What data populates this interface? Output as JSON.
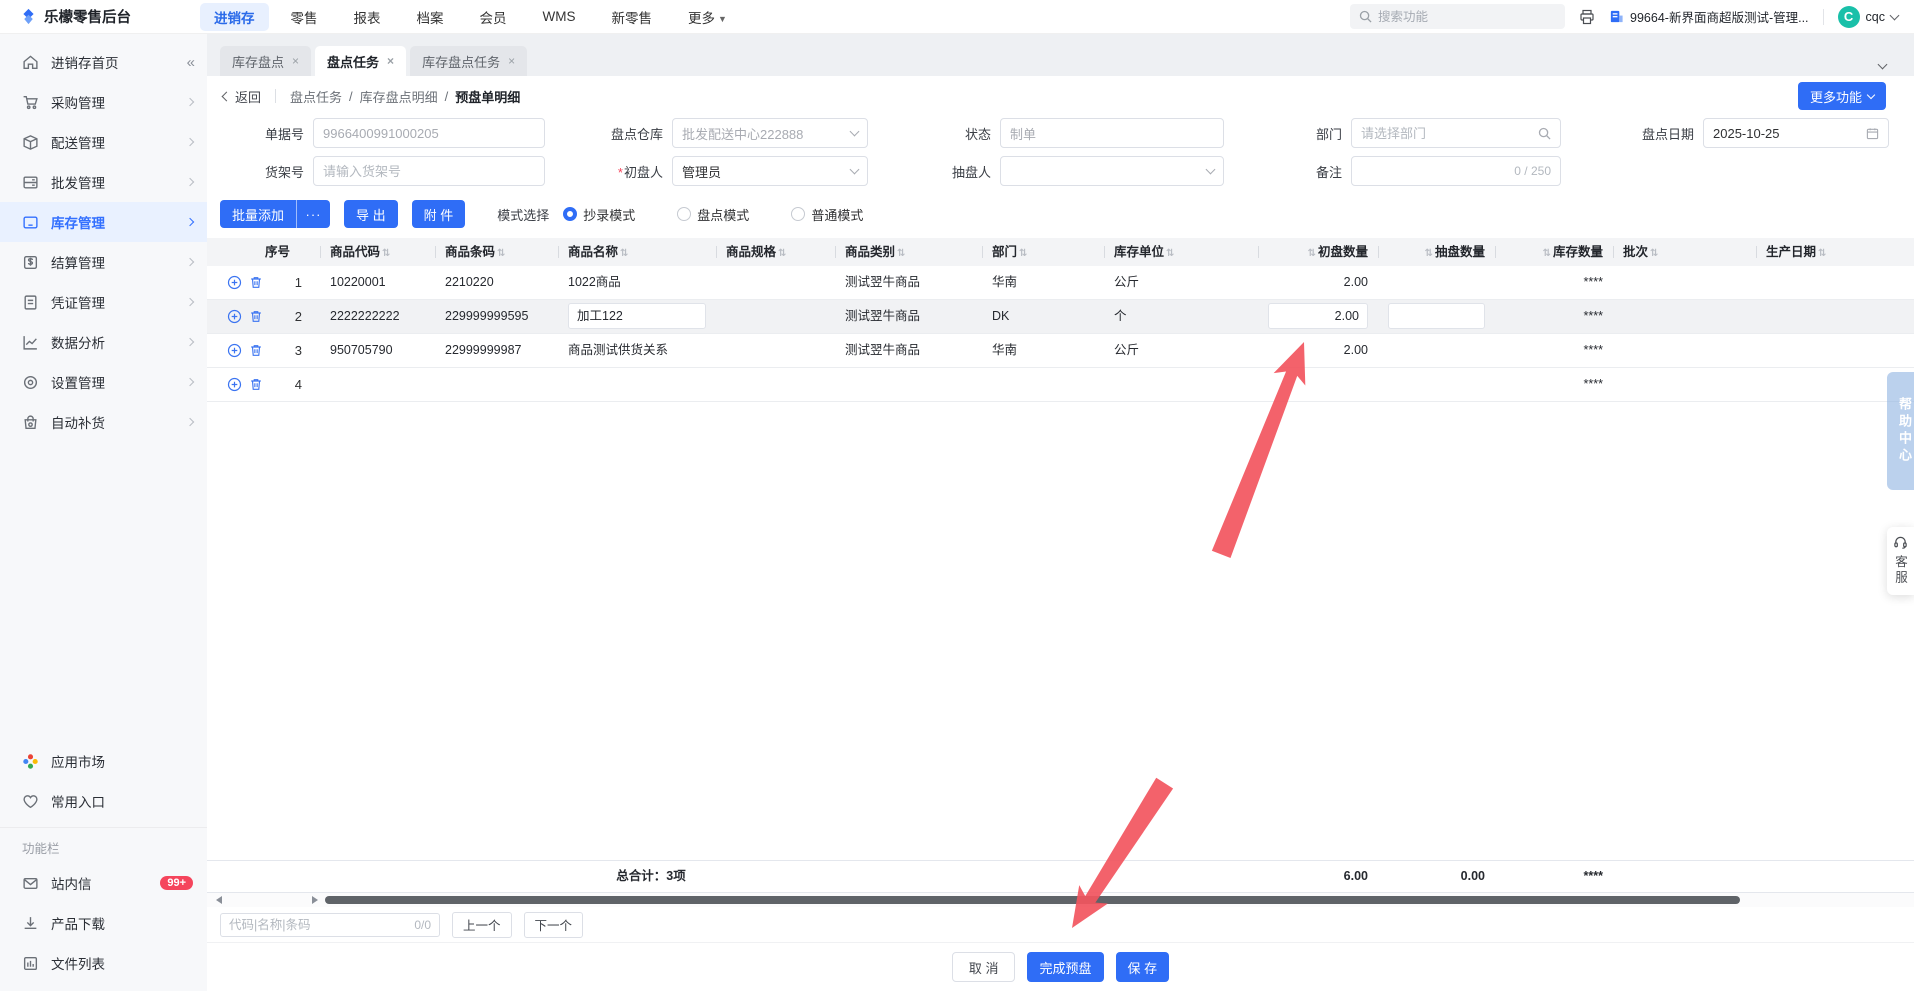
{
  "topbar": {
    "logo_text": "乐檬零售后台",
    "nav": [
      "进销存",
      "零售",
      "报表",
      "档案",
      "会员",
      "WMS",
      "新零售",
      "更多"
    ],
    "search_placeholder": "搜索功能",
    "company": "99664-新界面商超版测试-管理...",
    "avatar_letter": "C",
    "username": "cqc"
  },
  "sidebar": {
    "items": [
      {
        "label": "进销存首页"
      },
      {
        "label": "采购管理"
      },
      {
        "label": "配送管理"
      },
      {
        "label": "批发管理"
      },
      {
        "label": "库存管理"
      },
      {
        "label": "结算管理"
      },
      {
        "label": "凭证管理"
      },
      {
        "label": "数据分析"
      },
      {
        "label": "设置管理"
      },
      {
        "label": "自动补货"
      }
    ],
    "bottom_items": [
      {
        "label": "应用市场"
      },
      {
        "label": "常用入口"
      }
    ],
    "section_label": "功能栏",
    "tools": [
      {
        "label": "站内信",
        "badge": "99+"
      },
      {
        "label": "产品下载"
      },
      {
        "label": "文件列表"
      }
    ]
  },
  "tabs": [
    {
      "label": "库存盘点"
    },
    {
      "label": "盘点任务"
    },
    {
      "label": "库存盘点任务"
    }
  ],
  "breadcrumb": {
    "back_label": "返回",
    "path1": "盘点任务",
    "path2": "库存盘点明细",
    "current": "预盘单明细",
    "separator": "/",
    "more_button": "更多功能"
  },
  "form": {
    "doc_no": {
      "label": "单据号",
      "value": "9966400991000205"
    },
    "warehouse": {
      "label": "盘点仓库",
      "value": "批发配送中心222888"
    },
    "status": {
      "label": "状态",
      "value": "制单"
    },
    "dept": {
      "label": "部门",
      "placeholder": "请选择部门"
    },
    "date": {
      "label": "盘点日期",
      "value": "2025-10-25"
    },
    "shelf": {
      "label": "货架号",
      "placeholder": "请输入货架号"
    },
    "first_counter": {
      "label": "初盘人",
      "value": "管理员"
    },
    "sample_counter": {
      "label": "抽盘人",
      "value": ""
    },
    "remark": {
      "label": "备注",
      "counter": "0 / 250"
    }
  },
  "toolbar": {
    "batch_add": "批量添加",
    "batch_more": "···",
    "export": "导 出",
    "attachment": "附 件",
    "mode_label": "模式选择",
    "modes": [
      {
        "label": "抄录模式",
        "checked": true
      },
      {
        "label": "盘点模式",
        "checked": false
      },
      {
        "label": "普通模式",
        "checked": false
      }
    ]
  },
  "table": {
    "columns": [
      {
        "label": "序号"
      },
      {
        "label": "商品代码"
      },
      {
        "label": "商品条码"
      },
      {
        "label": "商品名称"
      },
      {
        "label": "商品规格"
      },
      {
        "label": "商品类别"
      },
      {
        "label": "部门"
      },
      {
        "label": "库存单位"
      },
      {
        "label": "初盘数量"
      },
      {
        "label": "抽盘数量"
      },
      {
        "label": "库存数量"
      },
      {
        "label": "批次"
      },
      {
        "label": "生产日期"
      }
    ],
    "rows": [
      {
        "no": "1",
        "code": "10220001",
        "barcode": "2210220",
        "name": "1022商品",
        "spec": "",
        "category": "测试翌牛商品",
        "dept": "华南",
        "unit": "公斤",
        "first_qty": "2.00",
        "sample_qty": "",
        "stock_qty": "****",
        "batch": "",
        "prod_date": ""
      },
      {
        "no": "2",
        "code": "2222222222",
        "barcode": "229999999595",
        "name": "加工122",
        "spec": "",
        "category": "测试翌牛商品",
        "dept": "DK",
        "unit": "个",
        "first_qty": "2.00",
        "sample_qty": "",
        "stock_qty": "****",
        "batch": "",
        "prod_date": ""
      },
      {
        "no": "3",
        "code": "950705790",
        "barcode": "22999999987",
        "name": "商品测试供货关系",
        "spec": "",
        "category": "测试翌牛商品",
        "dept": "华南",
        "unit": "公斤",
        "first_qty": "2.00",
        "sample_qty": "",
        "stock_qty": "****",
        "batch": "",
        "prod_date": ""
      },
      {
        "no": "4",
        "code": "",
        "barcode": "",
        "name": "",
        "spec": "",
        "category": "",
        "dept": "",
        "unit": "",
        "first_qty": "",
        "sample_qty": "",
        "stock_qty": "****",
        "batch": "",
        "prod_date": ""
      }
    ],
    "footer": {
      "total_label": "总合计：3项",
      "first_qty_total": "6.00",
      "sample_qty_total": "0.00",
      "stock_qty_total": "****"
    }
  },
  "bottombar": {
    "find_placeholder": "代码|名称|条码",
    "find_counter": "0/0",
    "prev_button": "上一个",
    "next_button": "下一个",
    "cancel_button": "取 消",
    "finish_button": "完成预盘",
    "save_button": "保 存"
  },
  "floating": {
    "help_center": "帮助中心",
    "customer_service": "客服"
  },
  "colors": {
    "accent_blue": "#2f6df6",
    "sidebar_active_blue": "#3370ff",
    "badge_red": "#f5455c",
    "arrow_red": "#f2555f",
    "avatar_teal": "#19c0a9"
  }
}
